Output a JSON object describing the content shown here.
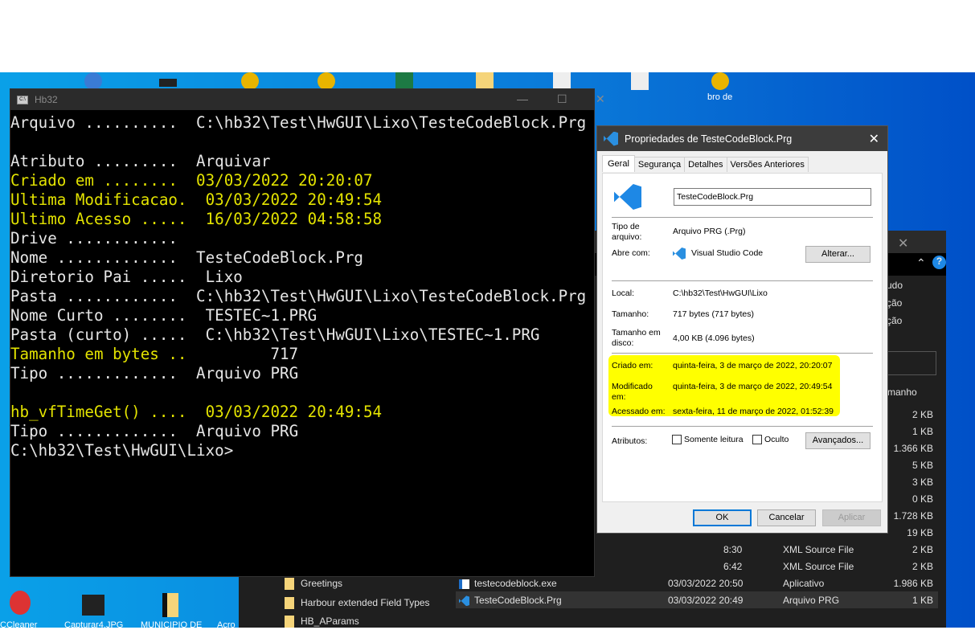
{
  "desktop": {
    "icons": [
      "CCleaner",
      "Capturar4.JPG",
      "MUNICIPIO DE",
      "Acro"
    ],
    "partial_labels": [
      "bro de"
    ]
  },
  "console": {
    "title": "Hb32",
    "lines": [
      {
        "label": "Arquivo ..........  ",
        "value": "C:\\hb32\\Test\\HwGUI\\Lixo\\TesteCodeBlock.Prg",
        "color": "w"
      },
      {
        "label": "",
        "value": "",
        "color": "w"
      },
      {
        "label": "Atributo .........  ",
        "value": "Arquivar",
        "color": "w"
      },
      {
        "label": "Criado em ........  ",
        "value": "03/03/2022 20:20:07",
        "color": "y"
      },
      {
        "label": "Ultima Modificacao.  ",
        "value": "03/03/2022 20:49:54",
        "color": "y"
      },
      {
        "label": "Ultimo Acesso .....  ",
        "value": "16/03/2022 04:58:58",
        "color": "y"
      },
      {
        "label": "Drive ............  ",
        "value": "",
        "color": "w"
      },
      {
        "label": "Nome .............  ",
        "value": "TesteCodeBlock.Prg",
        "color": "w"
      },
      {
        "label": "Diretorio Pai .....  ",
        "value": "Lixo",
        "color": "w"
      },
      {
        "label": "Pasta ............  ",
        "value": "C:\\hb32\\Test\\HwGUI\\Lixo\\TesteCodeBlock.Prg",
        "color": "w"
      },
      {
        "label": "Nome Curto ........  ",
        "value": "TESTEC~1.PRG",
        "color": "w"
      },
      {
        "label": "Pasta (curto) .....  ",
        "value": "C:\\hb32\\Test\\HwGUI\\Lixo\\TESTEC~1.PRG",
        "color": "w"
      },
      {
        "label": "Tamanho em bytes ..         ",
        "value": "717",
        "color": "y"
      },
      {
        "label": "Tipo .............  ",
        "value": "Arquivo PRG",
        "color": "w"
      },
      {
        "label": "",
        "value": "",
        "color": "w"
      },
      {
        "label": "hb_vfTimeGet() ....  ",
        "value": "03/03/2022 20:49:54",
        "color": "y"
      },
      {
        "label": "Tipo .............  ",
        "value": "Arquivo PRG",
        "color": "w"
      },
      {
        "label": "C:\\hb32\\Test\\HwGUI\\Lixo>",
        "value": "",
        "color": "w"
      }
    ]
  },
  "explorer": {
    "ribbon": [
      "udo",
      "ção",
      "ção"
    ],
    "size_header": "manho",
    "sizes": [
      "2 KB",
      "1 KB",
      "1.366 KB",
      "5 KB",
      "3 KB",
      "0 KB",
      "1.728 KB",
      "19 KB"
    ],
    "folders": [
      "Greetings",
      "Harbour extended Field Types",
      "HB_AParams"
    ],
    "files": [
      {
        "time": "8:30",
        "type": "XML Source File",
        "size": "2 KB"
      },
      {
        "time": "6:42",
        "type": "XML Source File",
        "size": "2 KB"
      },
      {
        "name": "testecodeblock.exe",
        "date": "03/03/2022 20:50",
        "type": "Aplicativo",
        "size": "1.986 KB"
      },
      {
        "name": "TesteCodeBlock.Prg",
        "date": "03/03/2022 20:49",
        "type": "Arquivo PRG",
        "size": "1 KB"
      }
    ]
  },
  "dialog": {
    "title": "Propriedades de TesteCodeBlock.Prg",
    "tabs": [
      "Geral",
      "Segurança",
      "Detalhes",
      "Versões Anteriores"
    ],
    "filename": "TesteCodeBlock.Prg",
    "tipo_label": "Tipo de arquivo:",
    "tipo_value": "Arquivo PRG (.Prg)",
    "abre_label": "Abre com:",
    "abre_value": "Visual Studio Code",
    "alterar": "Alterar...",
    "local_label": "Local:",
    "local_value": "C:\\hb32\\Test\\HwGUI\\Lixo",
    "tamanho_label": "Tamanho:",
    "tamanho_value": "717 bytes (717 bytes)",
    "disco_label": "Tamanho em disco:",
    "disco_value": "4,00 KB (4.096 bytes)",
    "criado_label": "Criado em:",
    "criado_value": "quinta-feira, 3 de março de 2022, 20:20:07",
    "modificado_label": "Modificado em:",
    "modificado_value": "quinta-feira, 3 de março de 2022, 20:49:54",
    "acessado_label": "Acessado em:",
    "acessado_value": "sexta-feira, 11 de março de 2022, 01:52:39",
    "atributos_label": "Atributos:",
    "somente_leitura": "Somente leitura",
    "oculto": "Oculto",
    "avancados": "Avançados...",
    "ok": "OK",
    "cancelar": "Cancelar",
    "aplicar": "Aplicar",
    "highlight_color": "#ffff00"
  }
}
